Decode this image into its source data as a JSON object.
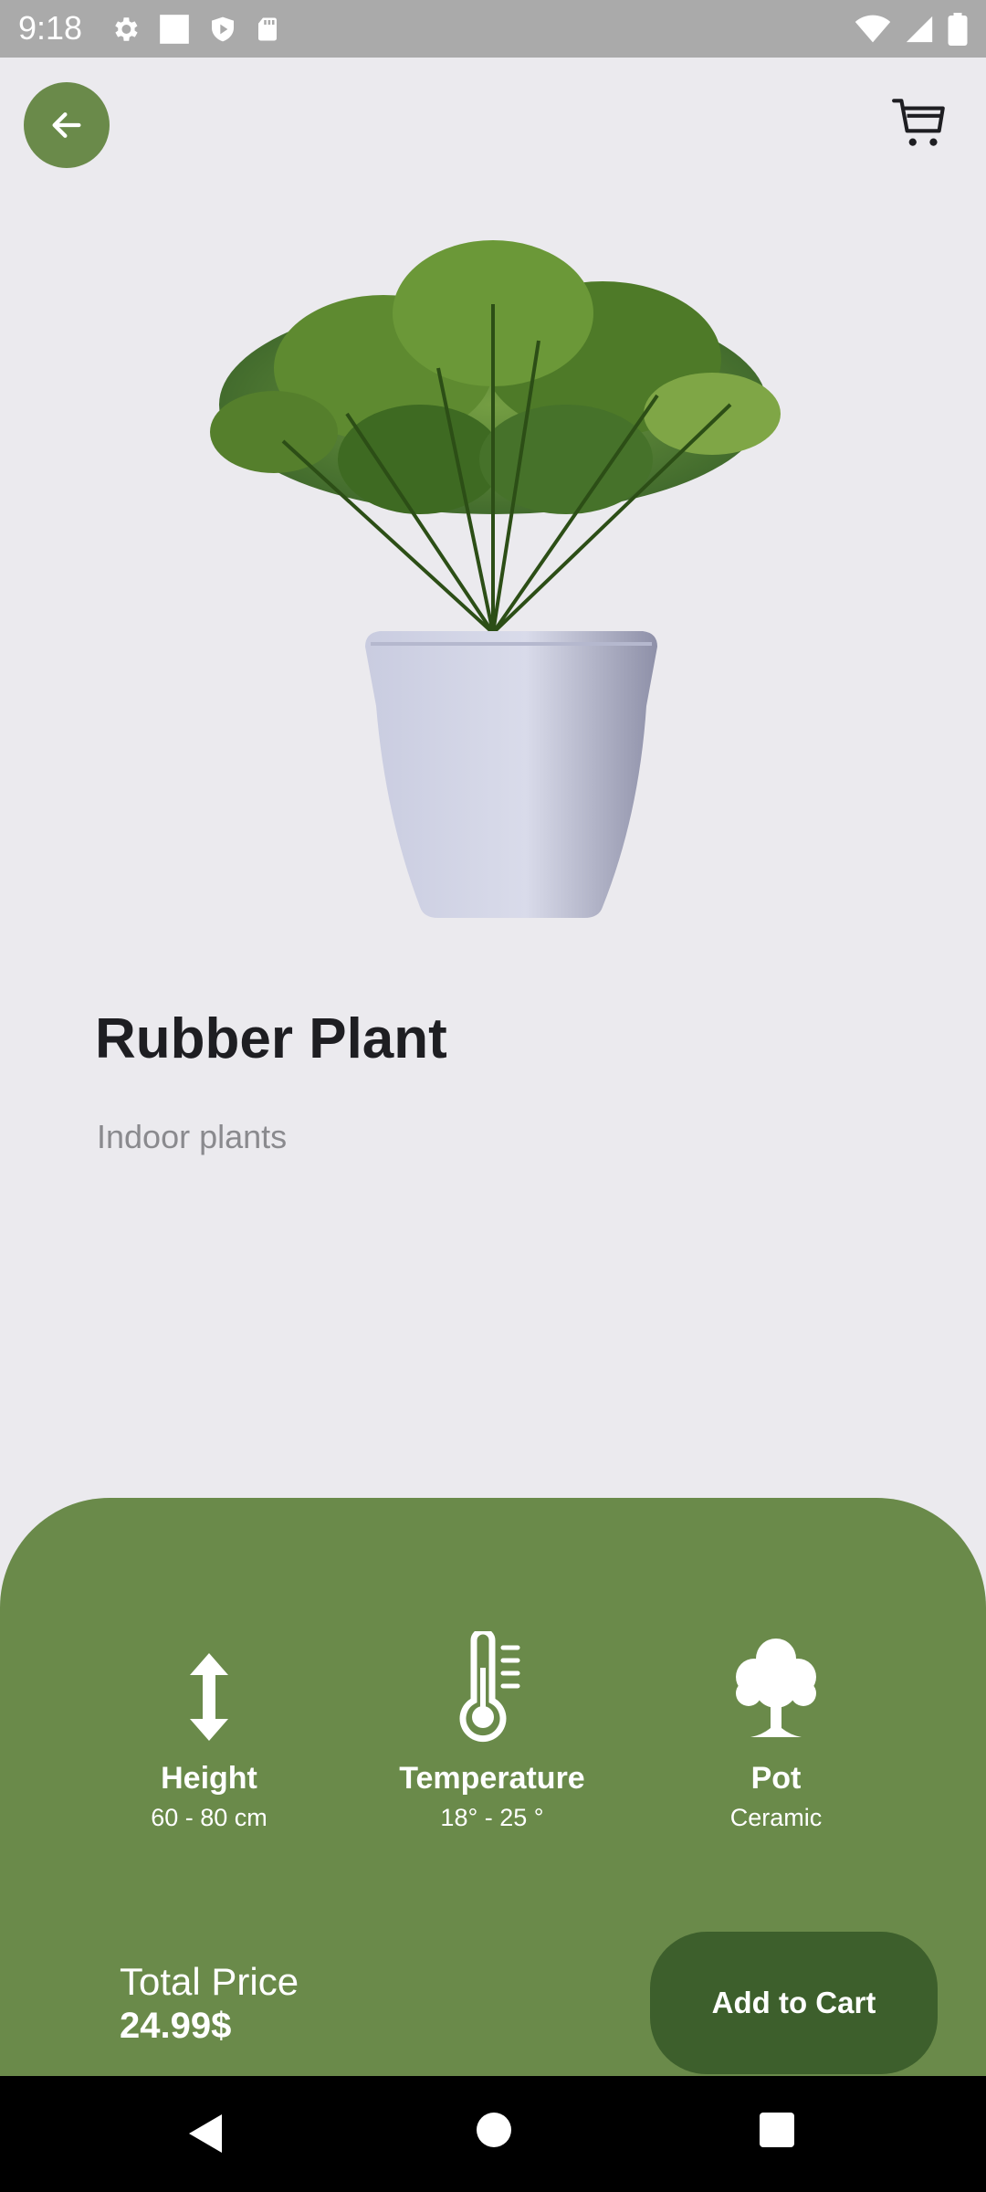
{
  "status_bar": {
    "time": "9:18",
    "left_icons": [
      "gear-icon",
      "square-icon",
      "shield-icon",
      "sd-card-icon"
    ],
    "right_icons": [
      "wifi-icon",
      "signal-icon",
      "battery-icon"
    ]
  },
  "header": {
    "back_icon": "arrow-left-icon",
    "cart_icon": "cart-icon"
  },
  "product": {
    "name": "Rubber Plant",
    "category": "Indoor plants",
    "image": "potted-plant"
  },
  "specs": [
    {
      "icon": "height-arrows-icon",
      "label": "Height",
      "value": "60 - 80 cm"
    },
    {
      "icon": "thermometer-icon",
      "label": "Temperature",
      "value": "18° - 25 °"
    },
    {
      "icon": "tree-icon",
      "label": "Pot",
      "value": "Ceramic"
    }
  ],
  "checkout": {
    "total_label": "Total Price",
    "total_value": "24.99$",
    "button_label": "Add to Cart"
  },
  "colors": {
    "accent": "#6A8A4A",
    "button_dark": "#3D5F2C",
    "background": "#EBEAEE",
    "title": "#1E1E22",
    "subtitle": "#8A8A8E"
  },
  "nav_bar": {
    "icons": [
      "back-triangle-icon",
      "home-circle-icon",
      "recents-square-icon"
    ]
  }
}
